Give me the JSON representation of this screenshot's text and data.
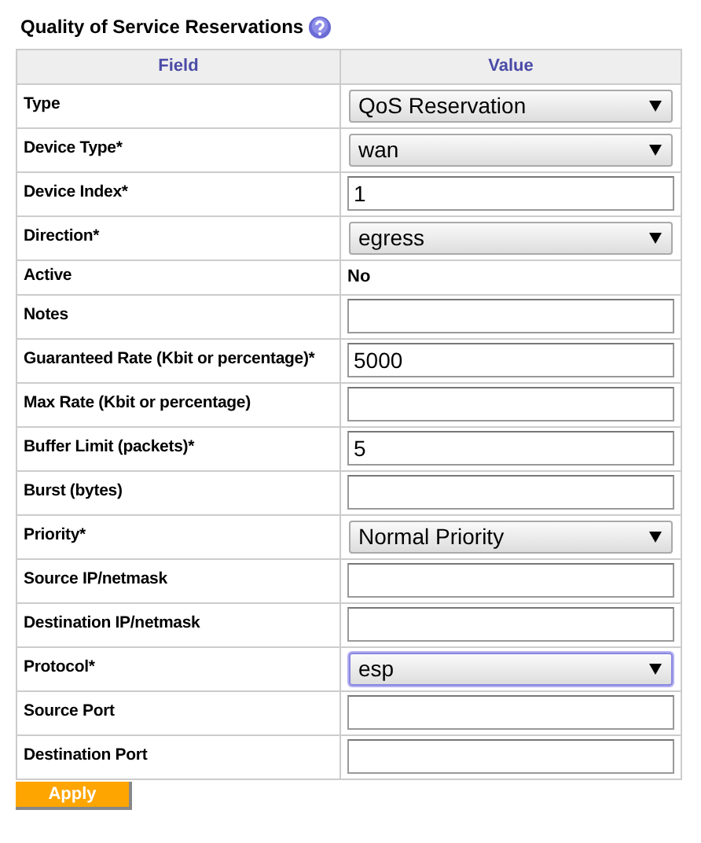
{
  "title": "Quality of Service Reservations",
  "table": {
    "columns": [
      "Field",
      "Value"
    ],
    "rows": [
      {
        "label": "Type",
        "kind": "select",
        "value": "QoS Reservation",
        "focused": false
      },
      {
        "label": "Device Type*",
        "kind": "select",
        "value": "wan",
        "focused": false
      },
      {
        "label": "Device Index*",
        "kind": "input",
        "value": "1"
      },
      {
        "label": "Direction*",
        "kind": "select",
        "value": "egress",
        "focused": false
      },
      {
        "label": "Active",
        "kind": "text",
        "value": "No"
      },
      {
        "label": "Notes",
        "kind": "input"
      },
      {
        "label": "Guaranteed Rate (Kbit or percentage)*",
        "kind": "input",
        "value": "5000"
      },
      {
        "label": "Max Rate (Kbit or percentage)",
        "kind": "input"
      },
      {
        "label": "Buffer Limit (packets)*",
        "kind": "input",
        "value": "5"
      },
      {
        "label": "Burst (bytes)",
        "kind": "input"
      },
      {
        "label": "Priority*",
        "kind": "select",
        "value": "Normal Priority",
        "focused": false
      },
      {
        "label": "Source IP/netmask",
        "kind": "input"
      },
      {
        "label": "Destination IP/netmask",
        "kind": "input"
      },
      {
        "label": "Protocol*",
        "kind": "select",
        "value": "esp",
        "focused": true
      },
      {
        "label": "Source Port",
        "kind": "input"
      },
      {
        "label": "Destination Port",
        "kind": "input"
      }
    ]
  },
  "apply_button": "Apply"
}
